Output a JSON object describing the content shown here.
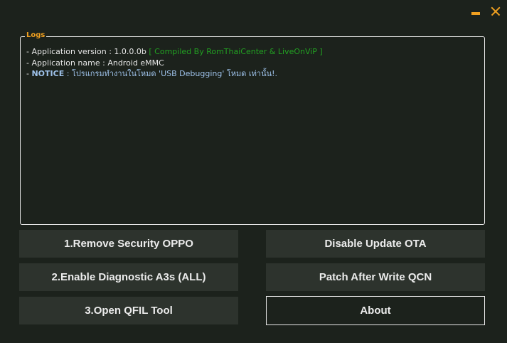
{
  "window": {
    "minimize_icon": "minimize-icon",
    "close_icon": "close-icon",
    "accent_color": "#f0a020"
  },
  "logs": {
    "title": "Logs",
    "line1_prefix": "- Application version : 1.0.0.0b",
    "line1_suffix": "[ Compiled By RomThaiCenter & LiveOnViP ]",
    "line2": "- Application name : Android eMMC",
    "line3_dash": "- ",
    "line3_label": "NOTICE",
    "line3_text": " : โปรแกรมทำงานในโหมด 'USB Debugging' โหมด เท่านั้น!."
  },
  "buttons": {
    "remove_security": "1.Remove Security OPPO",
    "enable_diag": "2.Enable Diagnostic A3s (ALL)",
    "open_qfil": "3.Open QFIL Tool",
    "disable_ota": "Disable Update OTA",
    "patch_qcn": "Patch After Write QCN",
    "about": "About"
  }
}
